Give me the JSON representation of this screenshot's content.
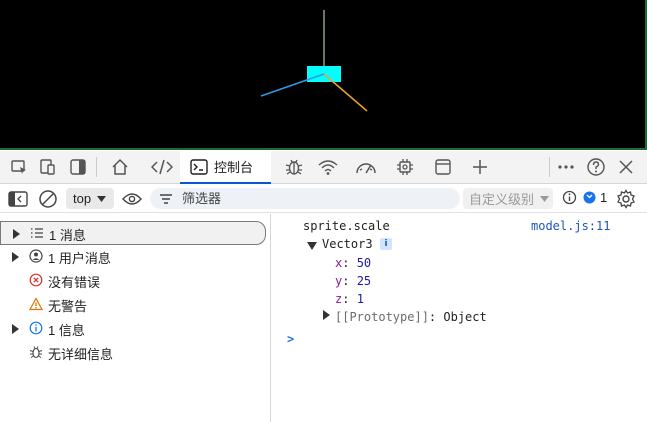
{
  "devtools": {
    "tabs": {
      "console_label": "控制台"
    },
    "toolbar": {
      "context": "top",
      "filter_placeholder": "筛选器",
      "levels_label": "自定义级别",
      "issues_count": "1"
    },
    "sidebar": {
      "items": [
        {
          "label": "1 消息",
          "expandable": true,
          "icon": "list-icon"
        },
        {
          "label": "1 用户消息",
          "expandable": true,
          "icon": "user-icon"
        },
        {
          "label": "没有错误",
          "expandable": false,
          "icon": "error-icon"
        },
        {
          "label": "无警告",
          "expandable": false,
          "icon": "warning-icon"
        },
        {
          "label": "1 信息",
          "expandable": true,
          "icon": "info-icon"
        },
        {
          "label": "无详细信息",
          "expandable": false,
          "icon": "bug-icon"
        }
      ]
    },
    "console": {
      "log_label": "sprite.scale",
      "source_link": "model.js:11",
      "object_type": "Vector3",
      "props": [
        {
          "key": "x",
          "value": "50"
        },
        {
          "key": "y",
          "value": "25"
        },
        {
          "key": "z",
          "value": "1"
        }
      ],
      "prototype_label": "[[Prototype]]",
      "prototype_value": "Object",
      "prompt": ">"
    },
    "colors": {
      "accent": "#0b57d0",
      "viewport_bg": "#000000",
      "viewport_border": "#1d6b3a",
      "sprite": "#00ffff"
    }
  }
}
